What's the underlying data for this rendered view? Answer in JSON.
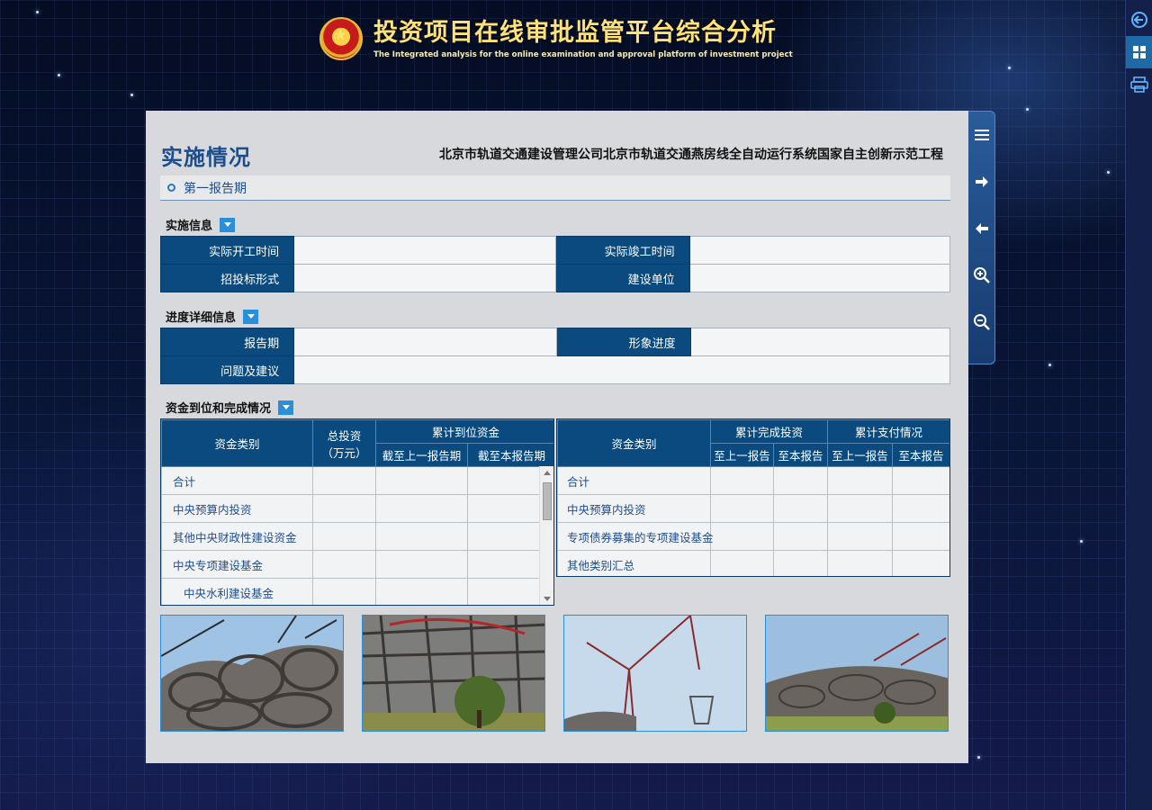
{
  "header": {
    "title_cn": "投资项目在线审批监管平台综合分析",
    "title_en": "The Integrated analysis for the online examination and approval platform of investment project",
    "emblem_icon": "national-emblem"
  },
  "right_strip": {
    "buttons": [
      "back-circle-icon",
      "grid-icon",
      "print-icon"
    ],
    "active_index": 1
  },
  "float_toolbar": {
    "buttons": [
      "menu-icon",
      "arrow-right-icon",
      "arrow-left-icon",
      "zoom-in-icon",
      "zoom-out-icon"
    ]
  },
  "panel": {
    "section_title": "实施情况",
    "project_name": "北京市轨道交通建设管理公司北京市轨道交通燕房线全自动运行系统国家自主创新示范工程",
    "period_tab": "第一报告期"
  },
  "implementation": {
    "title": "实施信息",
    "rows": [
      {
        "label1": "实际开工时间",
        "value1": "",
        "label2": "实际竣工时间",
        "value2": ""
      },
      {
        "label1": "招投标形式",
        "value1": "",
        "label2": "建设单位",
        "value2": ""
      }
    ]
  },
  "progress": {
    "title": "进度详细信息",
    "report_label": "报告期",
    "report_value": "",
    "image_label": "形象进度",
    "image_value": "",
    "issue_label": "问题及建议",
    "issue_value": ""
  },
  "funds": {
    "title": "资金到位和完成情况",
    "left": {
      "col_category": "资金类别",
      "col_total": "总投资",
      "col_total_unit": "（万元）",
      "col_group": "累计到位资金",
      "col_prev": "截至上一报告期",
      "col_curr": "截至本报告期",
      "rows": [
        {
          "name": "合计",
          "indent": false
        },
        {
          "name": "中央预算内投资",
          "indent": false
        },
        {
          "name": "其他中央财政性建设资金",
          "indent": false
        },
        {
          "name": "中央专项建设基金",
          "indent": false
        },
        {
          "name": "中央水利建设基金",
          "indent": true
        }
      ]
    },
    "right": {
      "col_category": "资金类别",
      "col_group1": "累计完成投资",
      "col_group2": "累计支付情况",
      "col_prev": "至上一报告",
      "col_curr": "至本报告",
      "rows": [
        "合计",
        "中央预算内投资",
        "专项债券募集的专项建设基金",
        "其他类别汇总"
      ]
    }
  },
  "colors": {
    "header_blue": "#0a4a7e",
    "title_gold": "#ffe27a",
    "accent": "#2a8fd8"
  },
  "photos": [
    "construction-photo-1",
    "construction-photo-2",
    "construction-photo-3",
    "construction-photo-4"
  ]
}
